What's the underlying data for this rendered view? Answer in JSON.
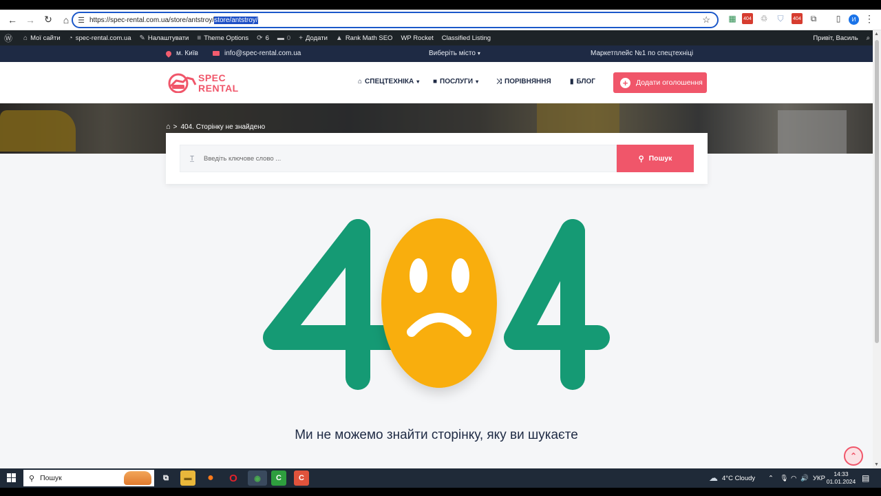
{
  "browser": {
    "url_prefix": "https://spec-rental.com.ua/store/antstroy/",
    "url_selected": "store/antstroy/",
    "profile_initial": "И"
  },
  "adminbar": {
    "my_sites": "Мої сайти",
    "site": "spec-rental.com.ua",
    "customize": "Налаштувати",
    "theme_options": "Theme Options",
    "updates_count": "6",
    "comments_count": "0",
    "add_new": "Додати",
    "rank_math": "Rank Math SEO",
    "wp_rocket": "WP Rocket",
    "classified": "Classified Listing",
    "greeting": "Привіт, Василь"
  },
  "topbar": {
    "city": "м. Київ",
    "email": "info@spec-rental.com.ua",
    "choose_city": "Виберіть місто",
    "tagline": "Маркетплейс №1 по спецтехніці"
  },
  "logo": {
    "line1": "SPEC",
    "line2": "RENTAL"
  },
  "nav": {
    "equipment": "СПЕЦТЕХНІКА",
    "services": "ПОСЛУГИ",
    "compare": "ПОРІВНЯННЯ",
    "blog": "БЛОГ",
    "add_listing": "Додати оголошення"
  },
  "breadcrumb": {
    "current": "404. Сторінку не знайдено"
  },
  "search": {
    "placeholder": "Введіть ключове слово ...",
    "button": "Пошук"
  },
  "error": {
    "code_left": "4",
    "code_right": "4",
    "message": "Ми не можемо знайти сторінку, яку ви шукаєте"
  },
  "taskbar": {
    "search_label": "Пошук",
    "weather": "4°C  Cloudy",
    "language": "УКР",
    "time": "14:33",
    "date": "01.01.2024"
  },
  "colors": {
    "accent": "#f0566a",
    "navy": "#1e2a44",
    "four_green": "#159a74",
    "face_yellow": "#f9ae08"
  }
}
